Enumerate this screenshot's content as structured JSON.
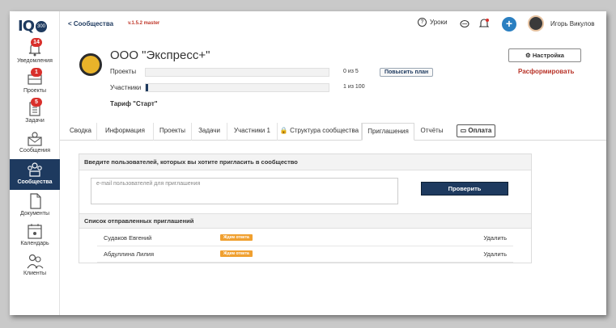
{
  "logo": {
    "text": "IQ",
    "badge": "300"
  },
  "sidebar": {
    "items": [
      {
        "label": "Уведомления",
        "badge": "14",
        "icon": "bell-icon"
      },
      {
        "label": "Проекты",
        "badge": "1",
        "icon": "briefcase-icon"
      },
      {
        "label": "Задачи",
        "badge": "5",
        "icon": "clipboard-icon"
      },
      {
        "label": "Сообщения",
        "badge": "",
        "icon": "envelope-icon"
      },
      {
        "label": "Сообщества",
        "badge": "",
        "icon": "community-icon",
        "active": true
      },
      {
        "label": "Документы",
        "badge": "",
        "icon": "document-icon"
      },
      {
        "label": "Календарь",
        "badge": "",
        "icon": "calendar-icon"
      },
      {
        "label": "Клиенты",
        "badge": "",
        "icon": "clients-icon"
      }
    ]
  },
  "header": {
    "back_link": "< Сообщества",
    "version": "v.1.5.2 master",
    "lessons": "Уроки",
    "user_name": "Игорь Викулов"
  },
  "community": {
    "title": "ООО \"Экспресс+\"",
    "projects_label": "Проекты",
    "projects_count": "0 из 5",
    "projects_fraction": 0,
    "members_label": "Участники",
    "members_count": "1 из 100",
    "members_fraction": 0.01,
    "upgrade_label": "Повысить план",
    "tariff": "Тариф \"Старт\"",
    "settings_label": "Настройка",
    "disband_label": "Расформировать"
  },
  "tabs": [
    {
      "label": "Сводка"
    },
    {
      "label": "Информация"
    },
    {
      "label": "Проекты"
    },
    {
      "label": "Задачи"
    },
    {
      "label": "Участники 1"
    },
    {
      "label": "Структура сообщества"
    },
    {
      "label": "Приглашения",
      "active": true
    },
    {
      "label": "Отчёты"
    },
    {
      "label": "Оплата"
    }
  ],
  "invite": {
    "heading": "Введите пользователей, которых вы хотите пригласить в сообщество",
    "placeholder": "e-mail пользователей для приглашения",
    "check_label": "Проверить",
    "list_heading": "Список отправленных приглашений",
    "rows": [
      {
        "name": "Судаков Евгений",
        "status": "Ждем ответа",
        "action": "Удалить"
      },
      {
        "name": "Абдуллина Лилия",
        "status": "Ждем ответа",
        "action": "Удалить"
      }
    ]
  }
}
